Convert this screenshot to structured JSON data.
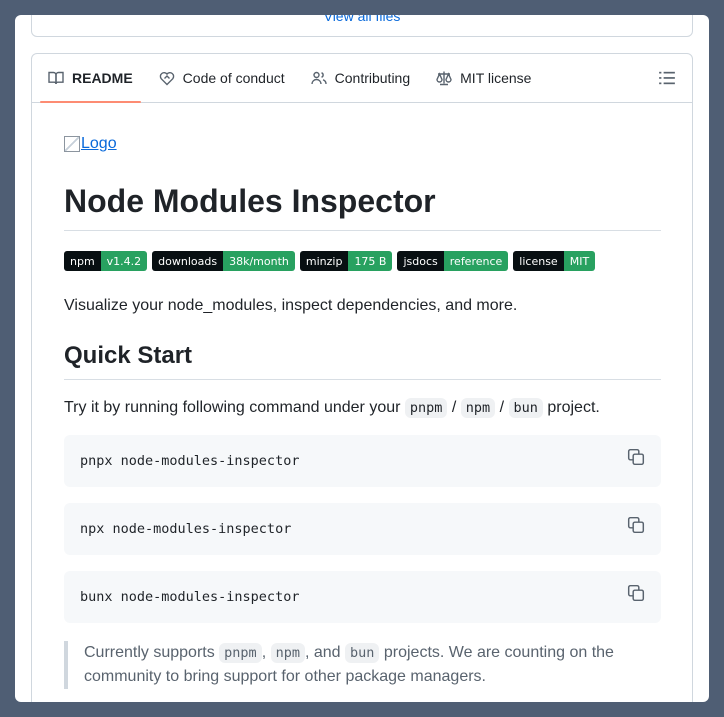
{
  "files_box": {
    "view_all_label": "View all files"
  },
  "tabs": [
    {
      "label": "README",
      "icon": "book-icon"
    },
    {
      "label": "Code of conduct",
      "icon": "heart-handshake-icon"
    },
    {
      "label": "Contributing",
      "icon": "people-icon"
    },
    {
      "label": "MIT license",
      "icon": "law-scale-icon"
    }
  ],
  "outline_icon": "list-outline-icon",
  "readme": {
    "logo_alt": "Logo",
    "title": "Node Modules Inspector",
    "badges": [
      {
        "key": "npm",
        "value": "v1.4.2"
      },
      {
        "key": "downloads",
        "value": "38k/month"
      },
      {
        "key": "minzip",
        "value": "175 B"
      },
      {
        "key": "jsdocs",
        "value": "reference"
      },
      {
        "key": "license",
        "value": "MIT"
      }
    ],
    "intro": "Visualize your node_modules, inspect dependencies, and more.",
    "quick_start_heading": "Quick Start",
    "try_prefix": "Try it by running following command under your",
    "pm_pnpm": "pnpm",
    "pm_npm": "npm",
    "pm_bun": "bun",
    "slash": "/",
    "try_suffix": "project.",
    "commands": [
      "pnpx node-modules-inspector",
      "npx node-modules-inspector",
      "bunx node-modules-inspector"
    ],
    "quote": {
      "prefix": "Currently supports",
      "comma": ",",
      "and": ", and",
      "suffix": "projects. We are counting on the community to bring support for other package managers."
    }
  },
  "colors": {
    "accent_underline": "#fd8c73",
    "link": "#0969da",
    "badge_key_bg": "#080f12",
    "badge_value_bg": "#28a160",
    "backdrop": "#4f5e74"
  }
}
